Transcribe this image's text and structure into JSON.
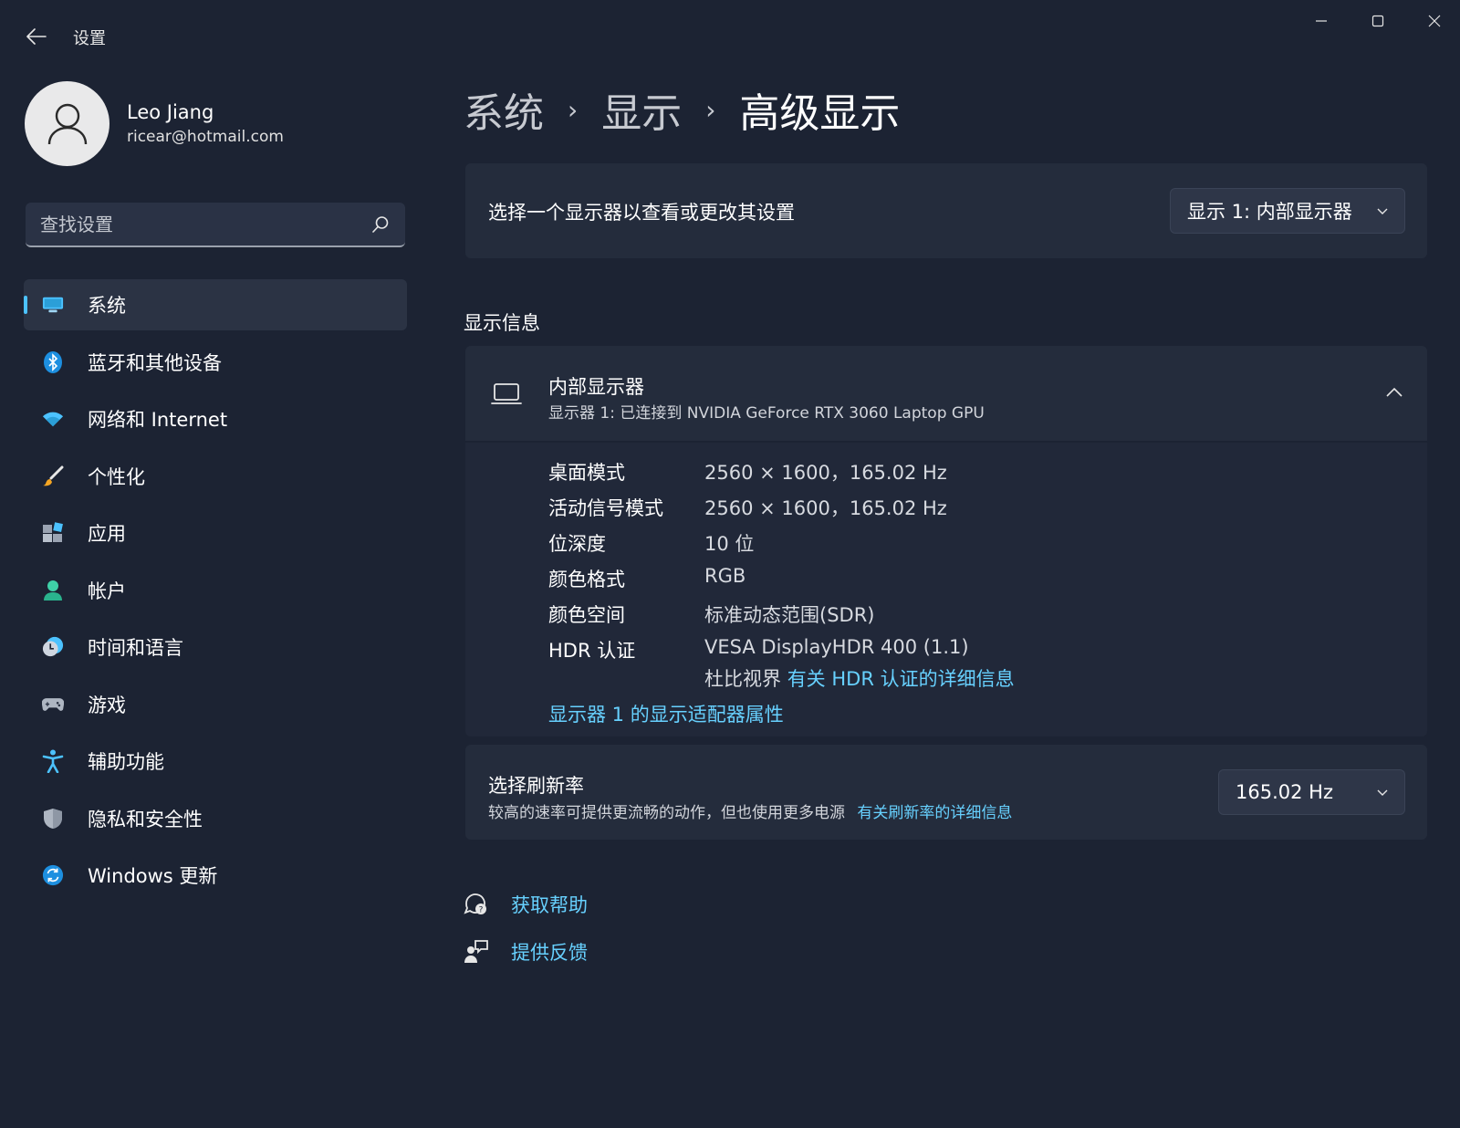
{
  "window": {
    "title": "设置"
  },
  "profile": {
    "name": "Leo Jiang",
    "email": "ricear@hotmail.com"
  },
  "search": {
    "placeholder": "查找设置"
  },
  "sidebar": {
    "items": [
      {
        "label": "系统",
        "icon": "system-icon",
        "active": true
      },
      {
        "label": "蓝牙和其他设备",
        "icon": "bluetooth-icon"
      },
      {
        "label": "网络和 Internet",
        "icon": "wifi-icon"
      },
      {
        "label": "个性化",
        "icon": "brush-icon"
      },
      {
        "label": "应用",
        "icon": "apps-icon"
      },
      {
        "label": "帐户",
        "icon": "account-icon"
      },
      {
        "label": "时间和语言",
        "icon": "time-language-icon"
      },
      {
        "label": "游戏",
        "icon": "gaming-icon"
      },
      {
        "label": "辅助功能",
        "icon": "accessibility-icon"
      },
      {
        "label": "隐私和安全性",
        "icon": "shield-icon"
      },
      {
        "label": "Windows 更新",
        "icon": "update-icon"
      }
    ]
  },
  "breadcrumb": {
    "items": [
      "系统",
      "显示",
      "高级显示"
    ]
  },
  "monitor_select": {
    "label": "选择一个显示器以查看或更改其设置",
    "value": "显示 1: 内部显示器"
  },
  "display_info": {
    "section_title": "显示信息",
    "title": "内部显示器",
    "subtitle": "显示器 1: 已连接到 NVIDIA GeForce RTX 3060 Laptop GPU",
    "props": [
      {
        "label": "桌面模式",
        "value": "2560 × 1600，165.02 Hz"
      },
      {
        "label": "活动信号模式",
        "value": "2560 × 1600，165.02 Hz"
      },
      {
        "label": "位深度",
        "value": "10 位"
      },
      {
        "label": "颜色格式",
        "value": "RGB"
      },
      {
        "label": "颜色空间",
        "value": "标准动态范围(SDR)"
      },
      {
        "label": "HDR 认证",
        "value": "VESA DisplayHDR 400 (1.1)"
      }
    ],
    "dolby_text": "杜比视界",
    "hdr_link": "有关 HDR 认证的详细信息",
    "adapter_link": "显示器 1 的显示适配器属性"
  },
  "refresh_rate": {
    "title": "选择刷新率",
    "subtitle": "较高的速率可提供更流畅的动作，但也使用更多电源",
    "link": "有关刷新率的详细信息",
    "value": "165.02 Hz"
  },
  "help": {
    "get_help": "获取帮助",
    "feedback": "提供反馈"
  },
  "colors": {
    "background": "#1c2333",
    "card": "#242c3c",
    "accent": "#4cc2ff",
    "link": "#67d1ff"
  }
}
